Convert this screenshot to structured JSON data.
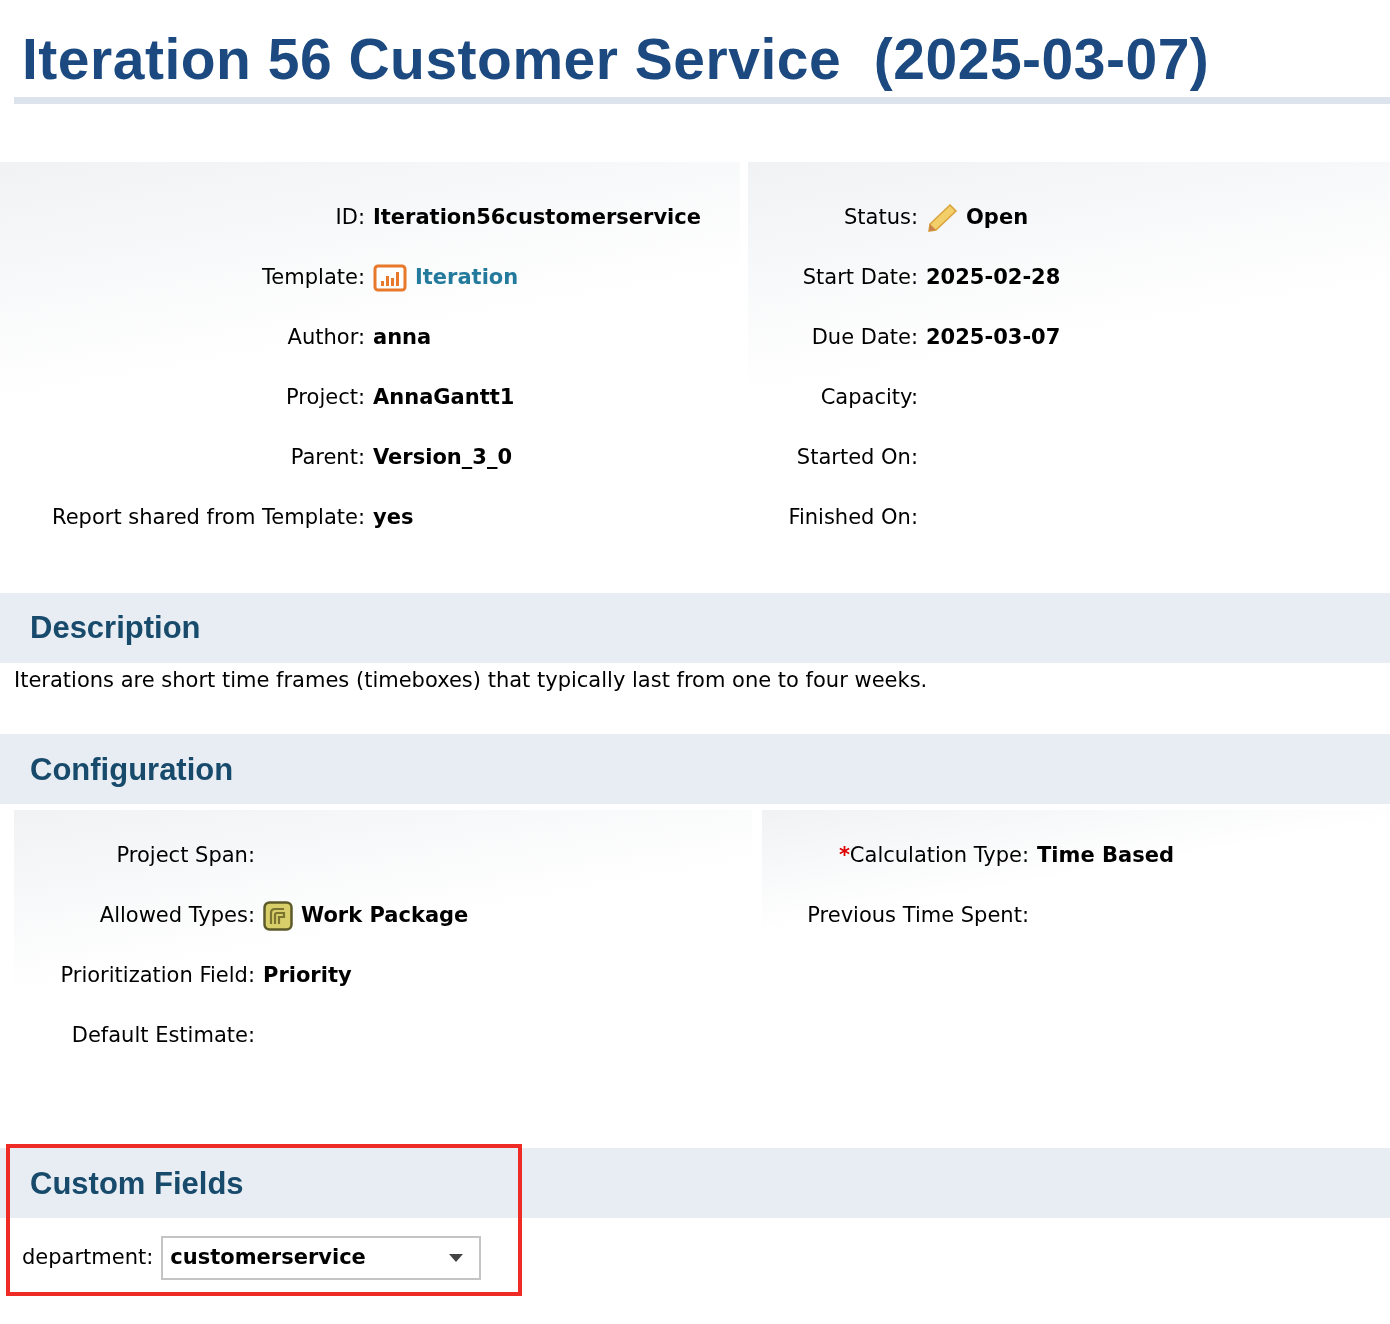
{
  "title": "Iteration 56 Customer Service  (2025-03-07)",
  "details": {
    "left": [
      {
        "label": "ID:",
        "value": "Iteration56customerservice",
        "kind": "text"
      },
      {
        "label": "Template:",
        "value": "Iteration",
        "kind": "template"
      },
      {
        "label": "Author:",
        "value": "anna",
        "kind": "text"
      },
      {
        "label": "Project:",
        "value": "AnnaGantt1",
        "kind": "text"
      },
      {
        "label": "Parent:",
        "value": "Version_3_0",
        "kind": "text"
      },
      {
        "label": "Report shared from Template:",
        "value": "yes",
        "kind": "text"
      }
    ],
    "right": [
      {
        "label": "Status:",
        "value": "Open",
        "kind": "status"
      },
      {
        "label": "Start Date:",
        "value": "2025-02-28",
        "kind": "text"
      },
      {
        "label": "Due Date:",
        "value": "2025-03-07",
        "kind": "text"
      },
      {
        "label": "Capacity:"
      },
      {
        "label": "Started On:"
      },
      {
        "label": "Finished On:"
      }
    ]
  },
  "description": {
    "heading": "Description",
    "text": "Iterations are short time frames (timeboxes) that typically last from one to four weeks."
  },
  "configuration": {
    "heading": "Configuration",
    "left": [
      {
        "label": "Project Span:"
      },
      {
        "label": "Allowed Types:",
        "value": "Work Package",
        "kind": "type"
      },
      {
        "label": "Prioritization Field:",
        "value": "Priority",
        "kind": "text"
      },
      {
        "label": "Default Estimate:"
      }
    ],
    "right": [
      {
        "label": "Calculation Type:",
        "value": "Time Based",
        "kind": "text",
        "required_mark": "*"
      },
      {
        "label": "Previous Time Spent:"
      }
    ]
  },
  "custom_fields": {
    "heading": "Custom Fields",
    "highlighted": true,
    "fields": [
      {
        "label": "department:",
        "value": "customerservice"
      }
    ]
  }
}
